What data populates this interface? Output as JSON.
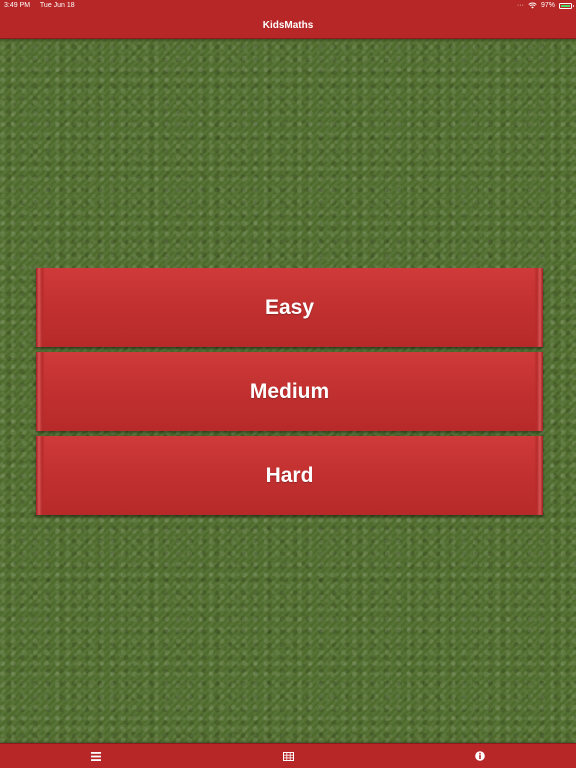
{
  "status_bar": {
    "time": "3:49 PM",
    "date": "Tue Jun 18",
    "battery_text": "97%",
    "battery_level": 0.97
  },
  "header": {
    "title": "KidsMaths"
  },
  "levels": [
    {
      "label": "Easy"
    },
    {
      "label": "Medium"
    },
    {
      "label": "Hard"
    }
  ],
  "tab_bar": {
    "tabs": [
      {
        "icon": "menu-icon"
      },
      {
        "icon": "table-icon"
      },
      {
        "icon": "info-icon"
      }
    ]
  },
  "colors": {
    "bar_red": "#b72727",
    "button_red": "#c43232",
    "background_green": "#4f6b2c",
    "battery_green": "#4cd964"
  }
}
